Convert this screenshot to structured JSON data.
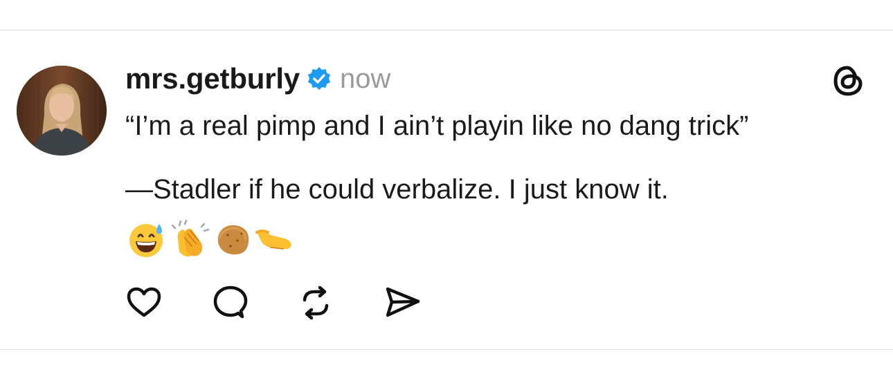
{
  "post": {
    "username": "mrs.getburly",
    "verified": true,
    "timestamp": "now",
    "lines": [
      "“I’m a real pimp and I ain’t playin like no dang trick”",
      "—Stadler if he could verbalize.  I just know it."
    ],
    "emojis": [
      "grinning-face-with-sweat-icon",
      "clapping-hands-icon",
      "potato-icon",
      "pinching-hand-icon"
    ]
  },
  "actions": [
    {
      "name": "like",
      "icon": "heart-icon"
    },
    {
      "name": "reply",
      "icon": "comment-icon"
    },
    {
      "name": "repost",
      "icon": "repost-icon"
    },
    {
      "name": "share",
      "icon": "send-icon"
    }
  ],
  "colors": {
    "verified_badge": "#1d9bf0",
    "timestamp": "#9a9a9a",
    "text": "#1a1a1a",
    "divider": "#dedede"
  }
}
